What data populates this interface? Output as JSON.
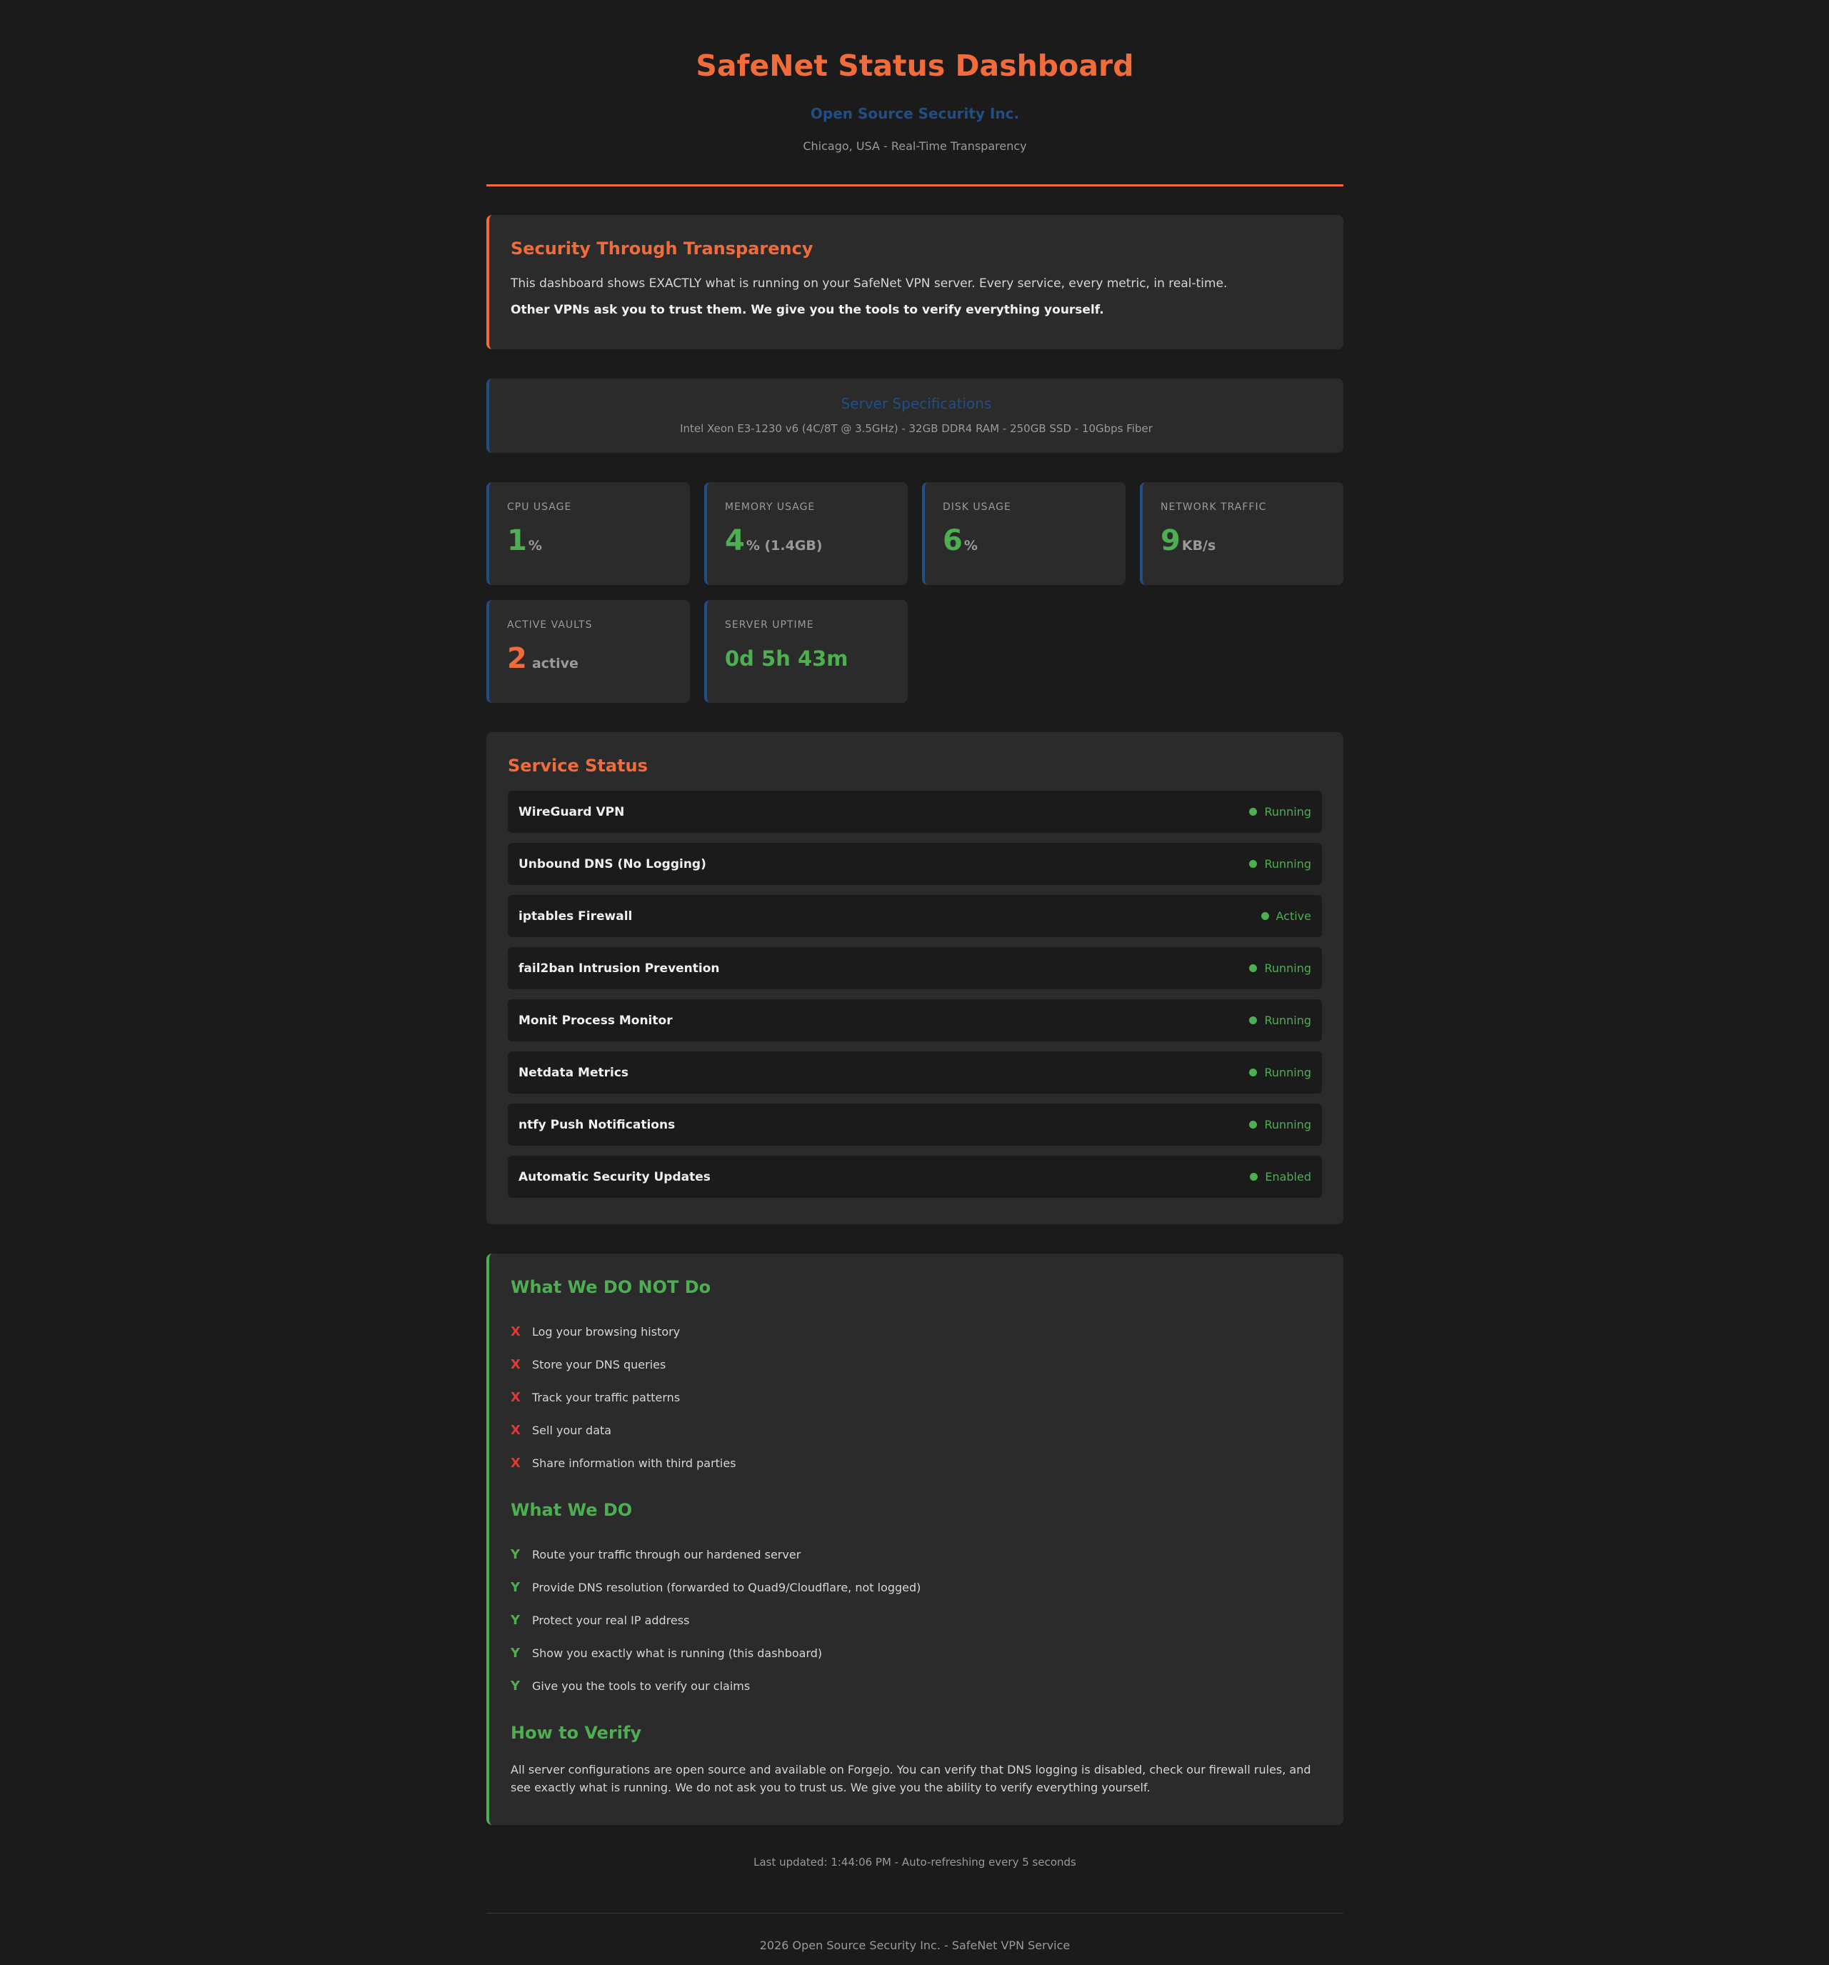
{
  "header": {
    "title": "SafeNet Status Dashboard",
    "company": "Open Source Security Inc.",
    "location": "Chicago, USA - Real-Time Transparency"
  },
  "transparency": {
    "title": "Security Through Transparency",
    "text": "This dashboard shows EXACTLY what is running on your SafeNet VPN server. Every service, every metric, in real-time.",
    "emphasis": "Other VPNs ask you to trust them. We give you the tools to verify everything yourself."
  },
  "specs": {
    "title": "Server Specifications",
    "line": "Intel Xeon E3-1230 v6 (4C/8T @ 3.5GHz) - 32GB DDR4 RAM - 250GB SSD - 10Gbps Fiber"
  },
  "metrics": [
    {
      "label": "CPU USAGE",
      "value": "1",
      "unit": "%"
    },
    {
      "label": "MEMORY USAGE",
      "value": "4",
      "unit": "% (1.4GB)"
    },
    {
      "label": "DISK USAGE",
      "value": "6",
      "unit": "%"
    },
    {
      "label": "NETWORK TRAFFIC",
      "value": "9",
      "unit": "KB/s"
    },
    {
      "label": "ACTIVE VAULTS",
      "value": "2",
      "unit": "active"
    },
    {
      "label": "SERVER UPTIME",
      "value": "0d 5h 43m",
      "unit": ""
    }
  ],
  "services": {
    "title": "Service Status",
    "items": [
      {
        "name": "WireGuard VPN",
        "status": "Running"
      },
      {
        "name": "Unbound DNS (No Logging)",
        "status": "Running"
      },
      {
        "name": "iptables Firewall",
        "status": "Active"
      },
      {
        "name": "fail2ban Intrusion Prevention",
        "status": "Running"
      },
      {
        "name": "Monit Process Monitor",
        "status": "Running"
      },
      {
        "name": "Netdata Metrics",
        "status": "Running"
      },
      {
        "name": "ntfy Push Notifications",
        "status": "Running"
      },
      {
        "name": "Automatic Security Updates",
        "status": "Enabled"
      }
    ]
  },
  "policy": {
    "dont_title": "What We DO NOT Do",
    "dont_mark": "X",
    "dont_items": [
      "Log your browsing history",
      "Store your DNS queries",
      "Track your traffic patterns",
      "Sell your data",
      "Share information with third parties"
    ],
    "do_title": "What We DO",
    "do_mark": "Y",
    "do_items": [
      "Route your traffic through our hardened server",
      "Provide DNS resolution (forwarded to Quad9/Cloudflare, not logged)",
      "Protect your real IP address",
      "Show you exactly what is running (this dashboard)",
      "Give you the tools to verify our claims"
    ],
    "verify_title": "How to Verify",
    "verify_text": "All server configurations are open source and available on Forgejo. You can verify that DNS logging is disabled, check our firewall rules, and see exactly what is running. We do not ask you to trust us. We give you the ability to verify everything yourself."
  },
  "updated": "Last updated: 1:44:06 PM - Auto-refreshing every 5 seconds",
  "footer": "2026 Open Source Security Inc. - SafeNet VPN Service",
  "colors": {
    "accent": "#f26b3a",
    "good": "#4caf50",
    "bad": "#e53935",
    "brand_blue": "#1f4f86"
  }
}
